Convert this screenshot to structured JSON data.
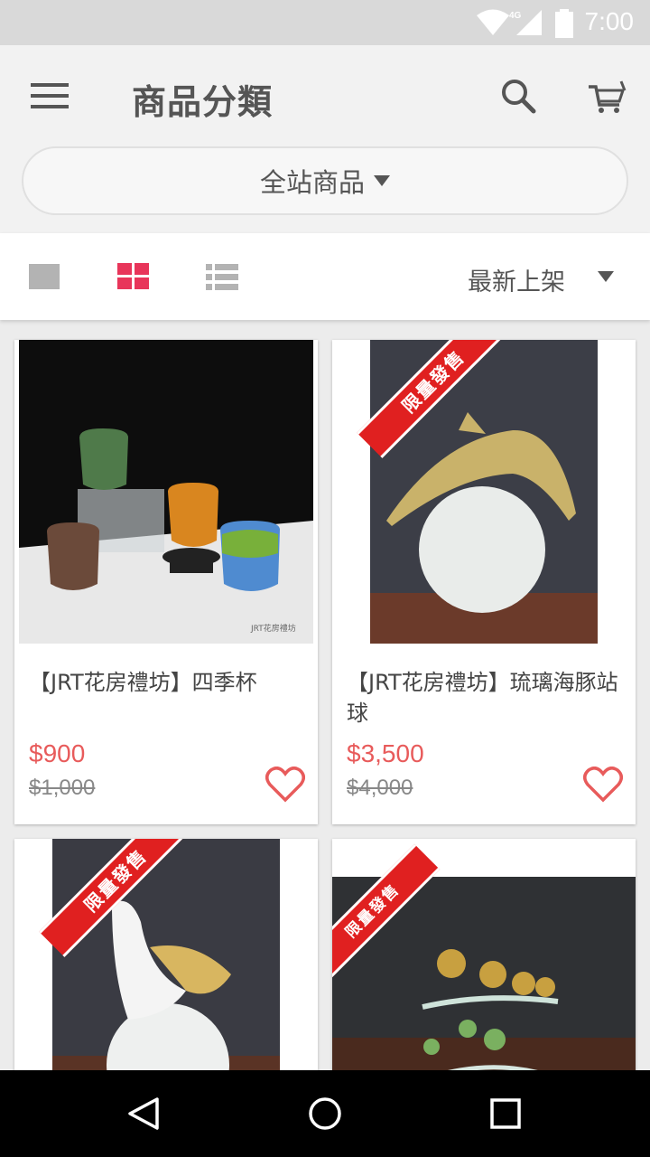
{
  "status_bar": {
    "time": "7:00",
    "network": "4G"
  },
  "header": {
    "title": "商品分類",
    "menu_icon": "hamburger-icon",
    "search_icon": "search-icon",
    "cart_icon": "cart-icon"
  },
  "category_filter": {
    "selected": "全站商品"
  },
  "toolbar": {
    "view_modes": [
      "single",
      "grid",
      "list"
    ],
    "active_view": "grid",
    "sort_selected": "最新上架"
  },
  "colors": {
    "accent": "#e8355a",
    "price": "#e85b5b",
    "ribbon": "#e02020"
  },
  "products": [
    {
      "name": "【JRT花房禮坊】四季杯",
      "price": "$900",
      "original_price": "$1,000",
      "watermark": "JRT花房禮坊",
      "limited": false
    },
    {
      "name": "【JRT花房禮坊】琉璃海豚站球",
      "price": "$3,500",
      "original_price": "$4,000",
      "ribbon": "限量發售",
      "limited": true
    },
    {
      "name": "",
      "price": "",
      "original_price": "",
      "ribbon": "限量發售",
      "limited": true
    },
    {
      "name": "",
      "price": "",
      "original_price": "",
      "ribbon": "限量發售",
      "limited": true
    }
  ],
  "nav_bar": {
    "back_icon": "back-icon",
    "home_icon": "home-icon",
    "recents_icon": "recents-icon"
  }
}
